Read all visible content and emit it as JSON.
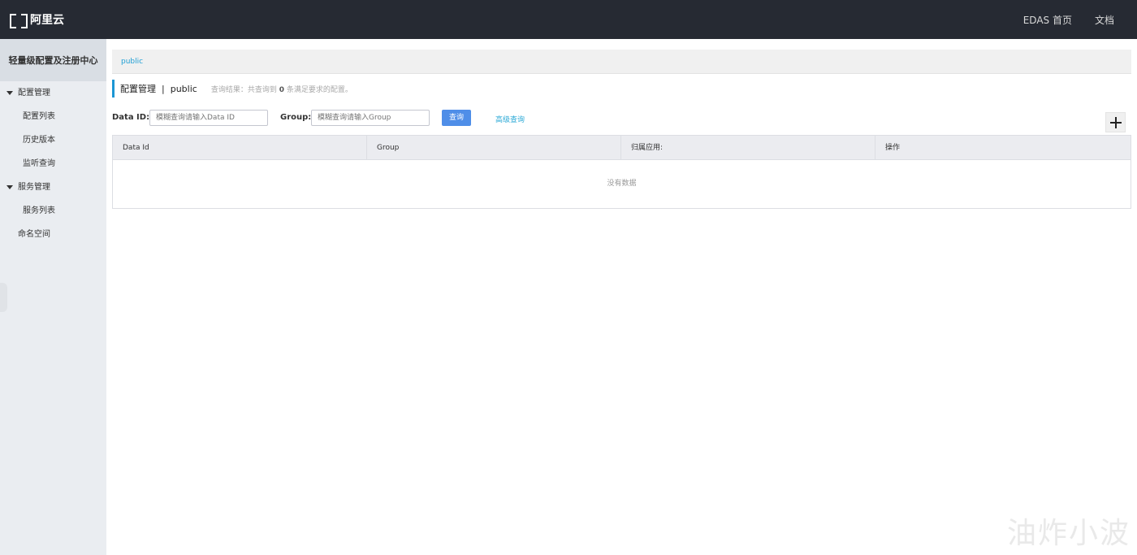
{
  "brand": {
    "logo_text": "阿里云"
  },
  "topnav": {
    "edas_home": "EDAS 首页",
    "docs": "文档"
  },
  "sidebar": {
    "title": "轻量级配置及注册中心",
    "config_group": "配置管理",
    "config_items": [
      "配置列表",
      "历史版本",
      "监听查询"
    ],
    "service_group": "服务管理",
    "service_items": [
      "服务列表"
    ],
    "namespace": "命名空间"
  },
  "breadcrumb": {
    "namespace": "public"
  },
  "page_header": {
    "title": "配置管理",
    "separator": "|",
    "namespace": "public",
    "result_prefix": "查询结果：共查询到",
    "result_count": "0",
    "result_suffix": "条满足要求的配置。"
  },
  "filter": {
    "data_id_label": "Data ID:",
    "data_id_placeholder": "模糊查询请输入Data ID",
    "group_label": "Group:",
    "group_placeholder": "模糊查询请输入Group",
    "search_label": "查询",
    "advanced_label": "高级查询"
  },
  "table": {
    "columns": [
      "Data Id",
      "Group",
      "归属应用:",
      "操作"
    ],
    "empty_text": "没有数据"
  },
  "watermark": "油炸小波",
  "colors": {
    "topbar": "#262a33",
    "accent": "#1b96d4",
    "button": "#4f8ee8",
    "link": "#2ba9d6"
  }
}
